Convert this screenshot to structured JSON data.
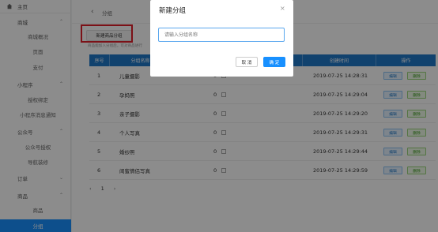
{
  "sidebar": {
    "home": "主页",
    "mall": "商城",
    "mall_overview": "商城概况",
    "pages": "页面",
    "payment": "支付",
    "miniprogram": "小程序",
    "auth_bind": "授权绑定",
    "mp_notify": "小程序消息通知",
    "official": "公众号",
    "official_auth": "公众号授权",
    "nav_decor": "导航装修",
    "orders": "订单",
    "goods": "商品",
    "goods_item": "商品",
    "groups_item": "分组"
  },
  "header": {
    "breadcrumb": "分组"
  },
  "toolbar": {
    "new_group_label": "新建商品分组",
    "hint": "商品能加入分组后，可对商品进行"
  },
  "table": {
    "headers": [
      "序号",
      "分组名称",
      "",
      "创建时间",
      "操作"
    ],
    "edit_label": "编辑",
    "delete_label": "删除",
    "rows": [
      {
        "no": "1",
        "name": "儿童摄影",
        "count": "0",
        "created": "2019-07-25 14:28:31"
      },
      {
        "no": "2",
        "name": "孕妈照",
        "count": "0",
        "created": "2019-07-25 14:29:04"
      },
      {
        "no": "3",
        "name": "亲子摄影",
        "count": "0",
        "created": "2019-07-25 14:29:20"
      },
      {
        "no": "4",
        "name": "个人写真",
        "count": "0",
        "created": "2019-07-25 14:29:31"
      },
      {
        "no": "5",
        "name": "婚纱照",
        "count": "0",
        "created": "2019-07-25 14:29:44"
      },
      {
        "no": "6",
        "name": "闺蜜情侣写真",
        "count": "0",
        "created": "2019-07-25 14:29:59"
      }
    ]
  },
  "pager": {
    "prev": "‹",
    "current": "1",
    "next": "›"
  },
  "modal": {
    "title": "新建分组",
    "close": "×",
    "placeholder": "请输入分组名称",
    "cancel_label": "取 消",
    "ok_label": "确 定"
  },
  "colors": {
    "primary": "#1890ff",
    "table_header": "#1f78c8",
    "highlight": "#e0202a"
  }
}
